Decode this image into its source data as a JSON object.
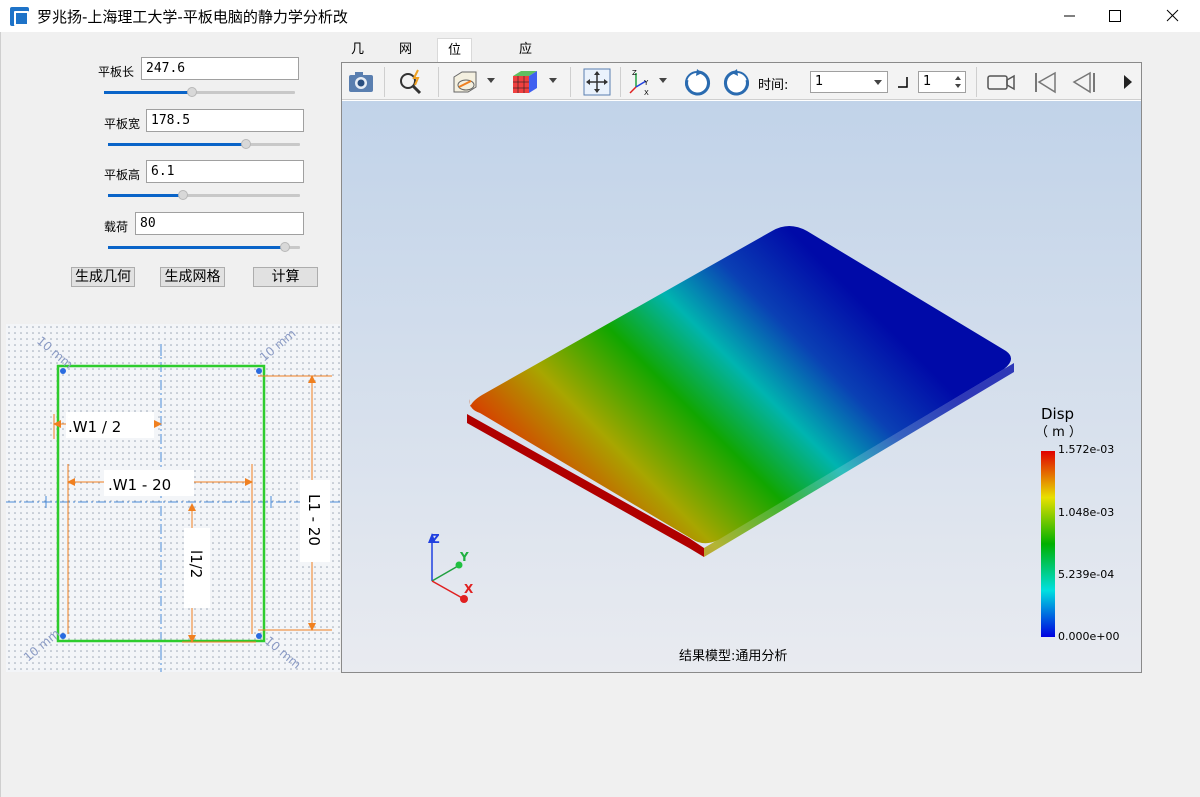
{
  "window": {
    "title": "罗兆扬-上海理工大学-平板电脑的静力学分析改",
    "minimize_icon": "minimize-icon",
    "maximize_icon": "maximize-icon",
    "close_icon": "close-icon"
  },
  "params": {
    "length": {
      "label": "平板长",
      "value": "247.6",
      "slider": 0.46
    },
    "width": {
      "label": "平板宽",
      "value": "178.5",
      "slider": 0.72
    },
    "height": {
      "label": "平板高",
      "value": "6.1",
      "slider": 0.39
    },
    "load": {
      "label": "载荷",
      "value": "80",
      "slider": 0.92
    }
  },
  "buttons": {
    "gen_geometry": "生成几何",
    "gen_mesh": "生成网格",
    "compute": "计算"
  },
  "sketch": {
    "dim_w_half": ".W1 / 2",
    "dim_w_minus": ".W1 - 20",
    "dim_l_half": "l1/2",
    "dim_l_minus": "L1 - 20",
    "corner_label": "10 mm"
  },
  "tabs": [
    "几何",
    "网格",
    "位移云图",
    "应力云图"
  ],
  "active_tab": 2,
  "toolbar": {
    "icons": [
      "camera-icon",
      "zoom-icon",
      "display-style-icon",
      "color-cube-icon",
      "fit-view-icon",
      "axis-orient-icon",
      "rotate-cw-icon",
      "rotate-ccw-icon",
      "video-icon",
      "first-frame-icon",
      "prev-frame-icon",
      "next-icon"
    ],
    "time_label": "时间:",
    "time_value": "1",
    "step_value": "1"
  },
  "viewer": {
    "legend_title": "Disp",
    "legend_unit": "（ m ）",
    "legend_ticks": [
      "1.572e-03",
      "1.048e-03",
      "5.239e-04",
      "0.000e+00"
    ],
    "axes": {
      "x": "X",
      "y": "Y",
      "z": "Z"
    },
    "footer": "结果模型:通用分析",
    "colors": {
      "max": "#e00000",
      "mid": "#00b000",
      "low": "#00e0e0",
      "min": "#0000c8"
    }
  }
}
